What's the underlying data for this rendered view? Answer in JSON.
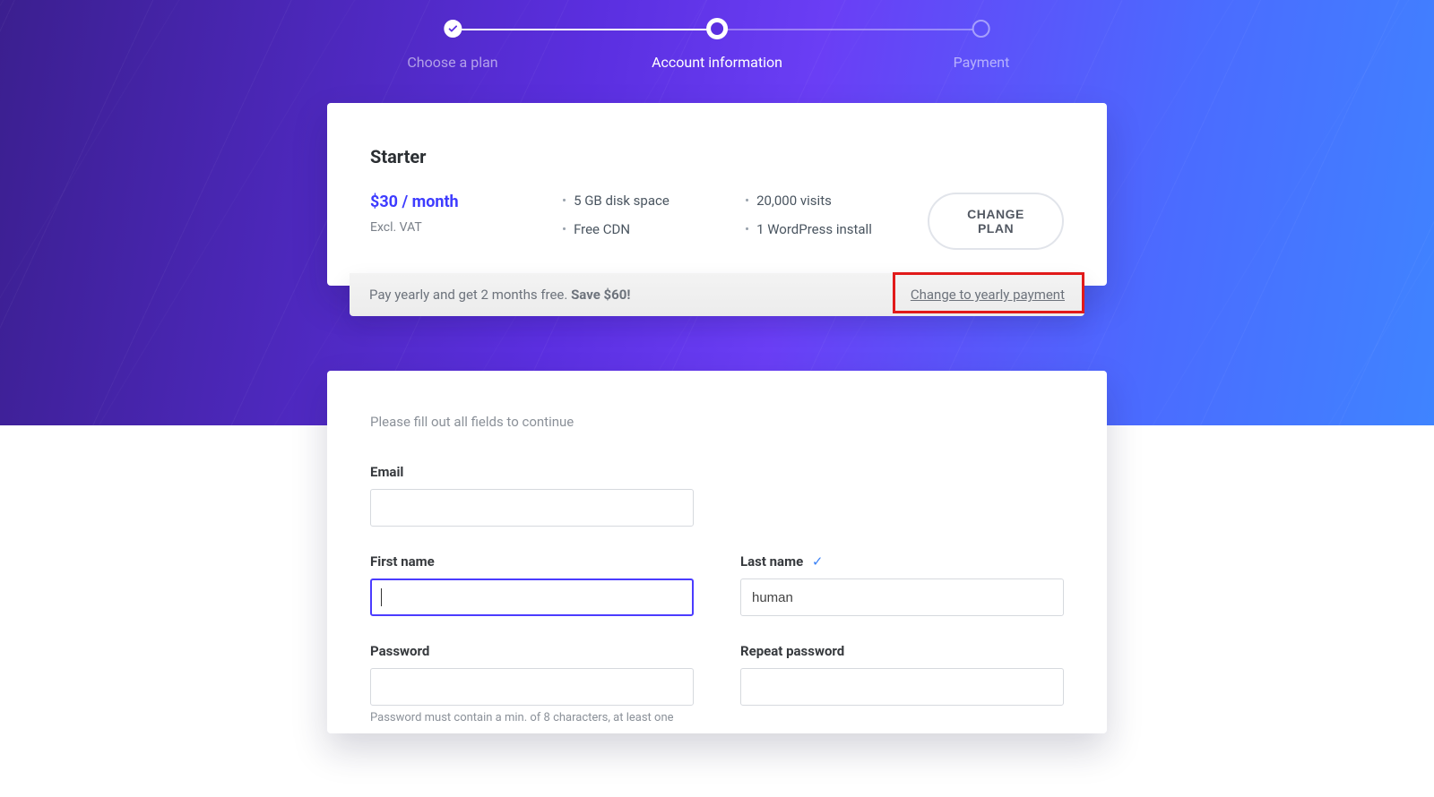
{
  "stepper": {
    "steps": [
      {
        "label": "Choose a plan",
        "state": "done"
      },
      {
        "label": "Account information",
        "state": "current"
      },
      {
        "label": "Payment",
        "state": "upcoming"
      }
    ]
  },
  "plan": {
    "name": "Starter",
    "price": "$30 / month",
    "note": "Excl. VAT",
    "features_col1": [
      "5 GB disk space",
      "Free CDN"
    ],
    "features_col2": [
      "20,000 visits",
      "1 WordPress install"
    ],
    "change_label": "CHANGE PLAN"
  },
  "yearly": {
    "text_prefix": "Pay yearly and get 2 months free. ",
    "text_bold": "Save $60!",
    "link": "Change to yearly payment"
  },
  "form": {
    "intro": "Please fill out all fields to continue",
    "email_label": "Email",
    "email_value": "",
    "first_label": "First name",
    "first_value": "",
    "last_label": "Last name",
    "last_value": "human",
    "last_ok": "✓",
    "password_label": "Password",
    "password_value": "",
    "repeat_label": "Repeat password",
    "repeat_value": "",
    "password_hint": "Password must contain a min. of 8 characters, at least one"
  }
}
